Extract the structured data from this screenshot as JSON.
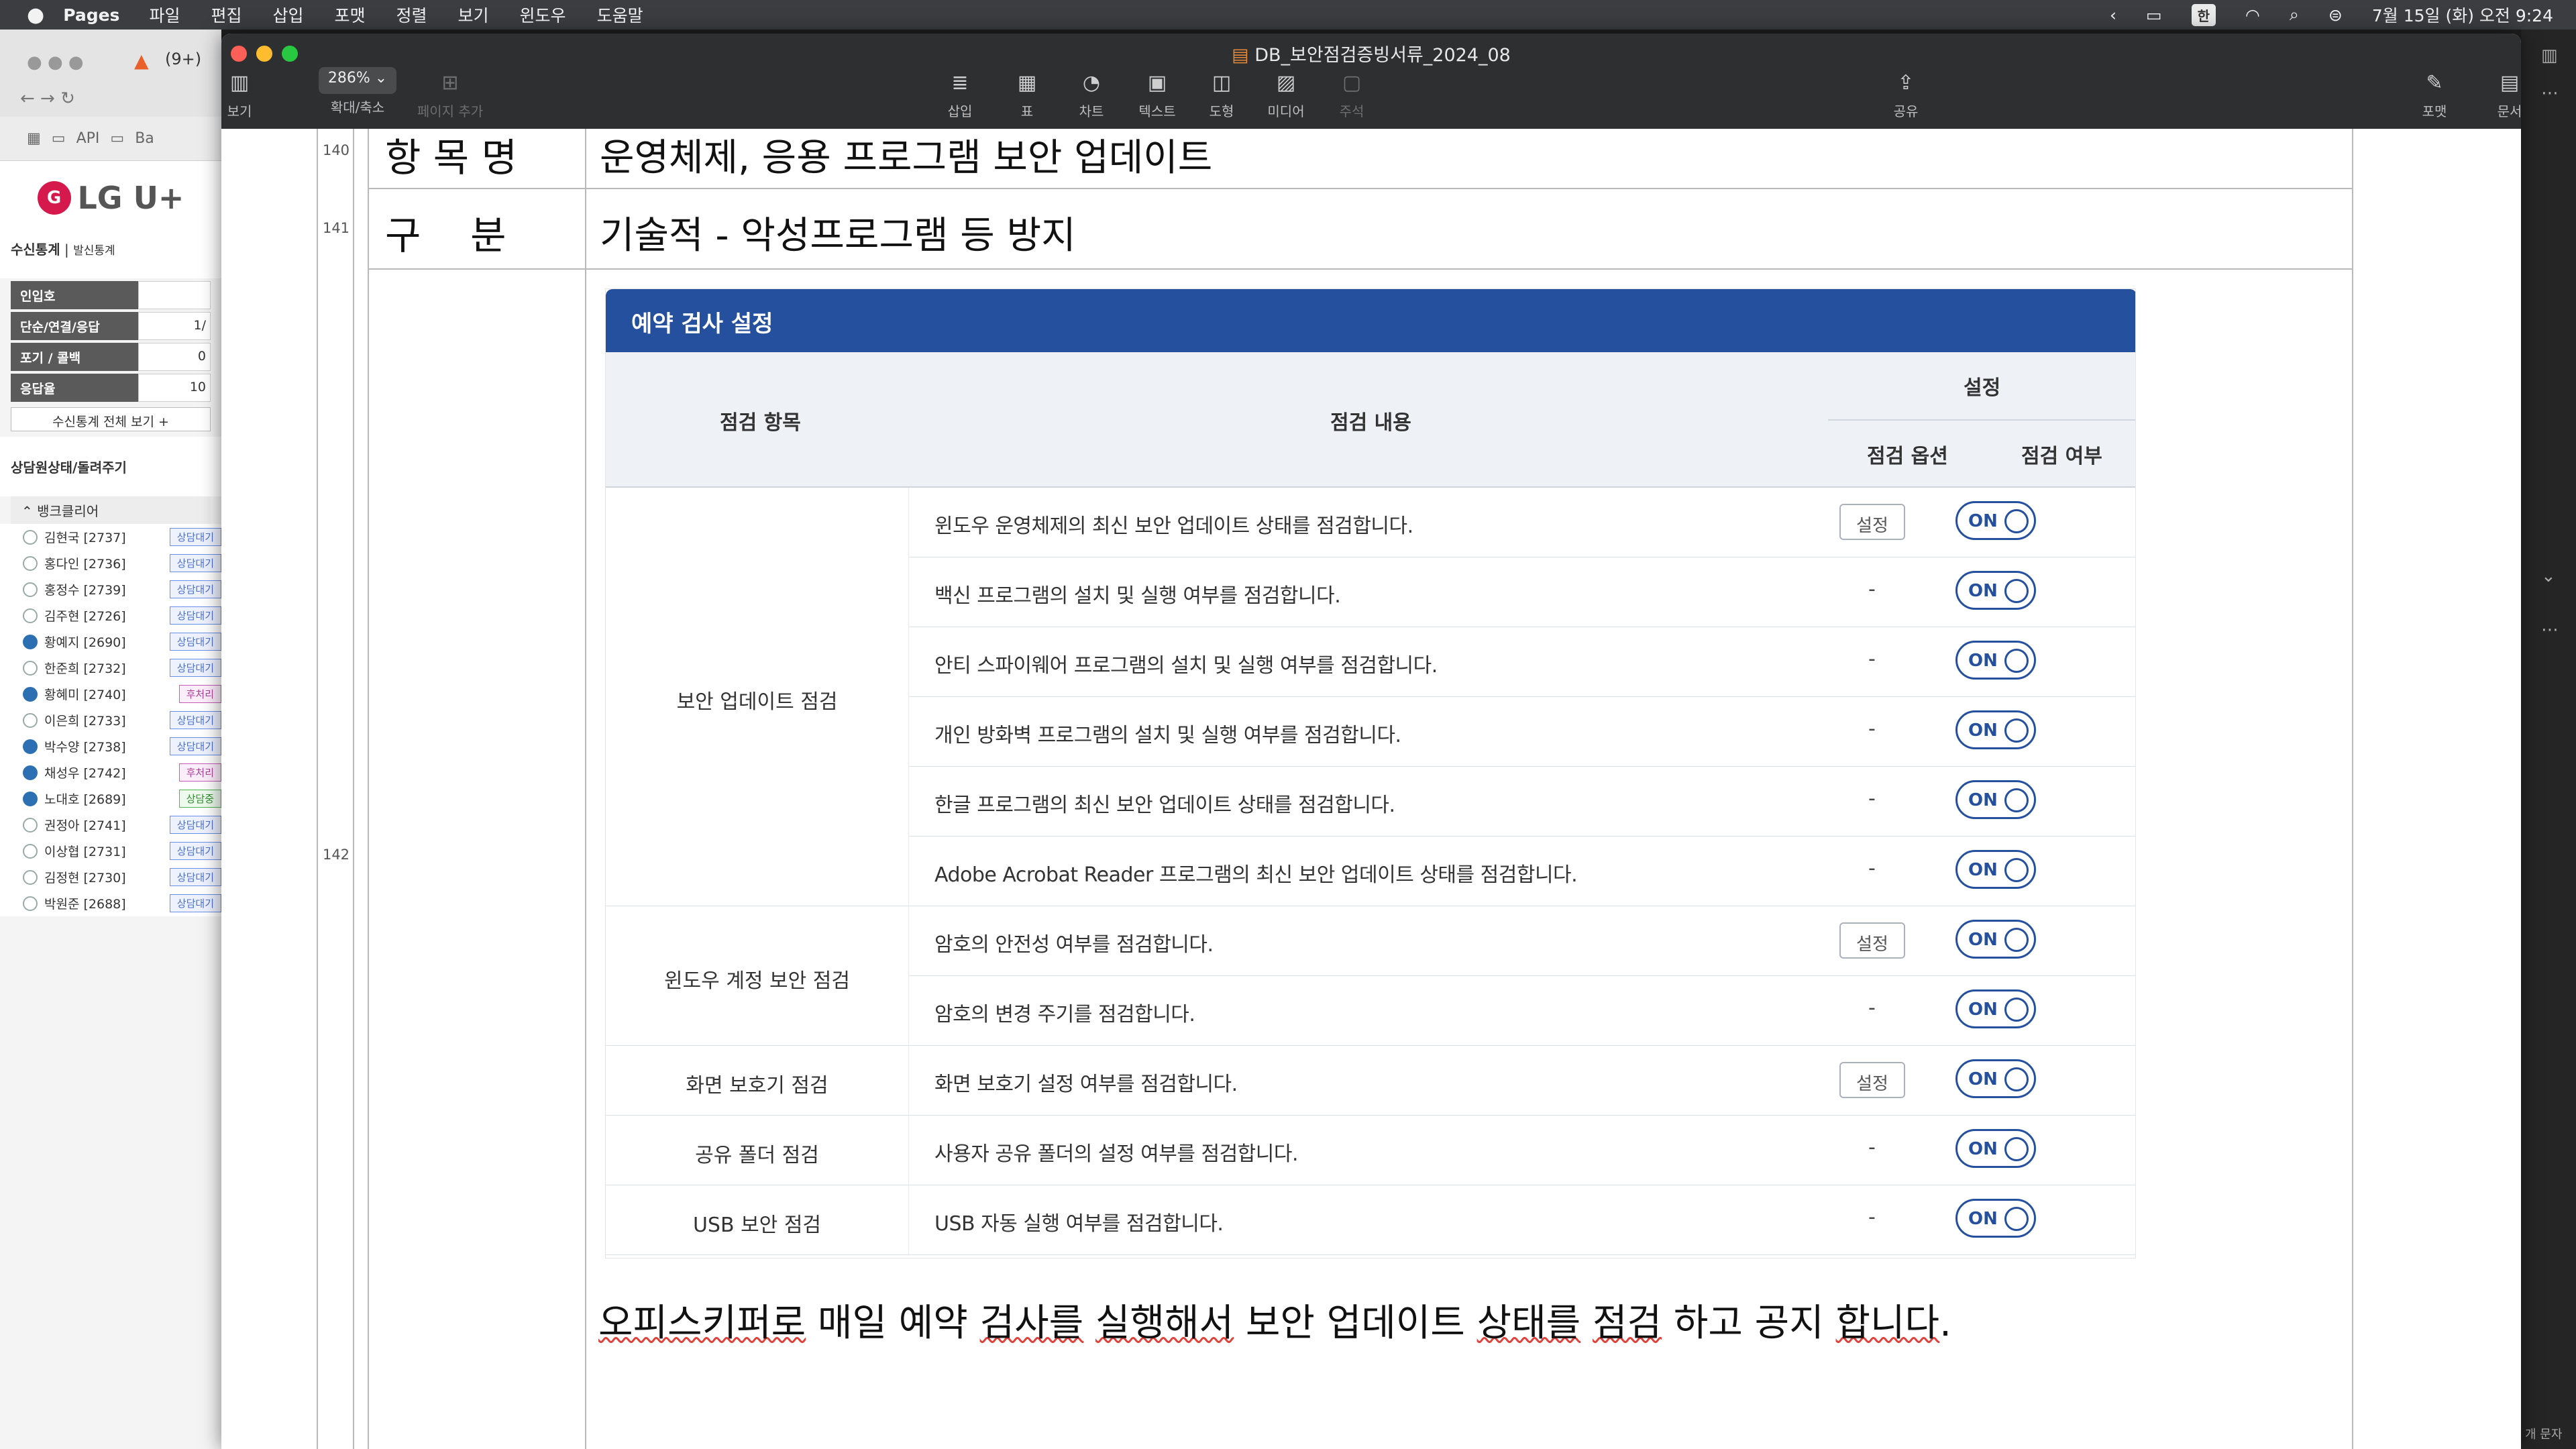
{
  "menubar": {
    "app": "Pages",
    "items": [
      "파일",
      "편집",
      "삽입",
      "포맷",
      "정렬",
      "보기",
      "윈도우",
      "도움말"
    ],
    "input_source": "한",
    "datetime": "7월 15일 (화) 오전 9:24"
  },
  "bg_browser": {
    "tab_label": "(9+)",
    "bookmarks": [
      "API",
      "Ba"
    ],
    "logo": "LG U+",
    "stats_tabs": {
      "active": "수신통계",
      "inactive": "발신통계"
    },
    "stats": [
      {
        "label": "인입호",
        "value": ""
      },
      {
        "label": "단순/연결/응답",
        "value": "1/"
      },
      {
        "label": "포기 / 콜백",
        "value": "0"
      },
      {
        "label": "응답율",
        "value": "10"
      }
    ],
    "more_button": "수신통계 전체 보기 +",
    "section_title": "상담원상태/돌려주기",
    "group_name": "뱅크클리어",
    "agents": [
      {
        "name": "김현국 [2737]",
        "status": "상담대기",
        "tone": "b",
        "active": false
      },
      {
        "name": "홍다인 [2736]",
        "status": "상담대기",
        "tone": "b",
        "active": false
      },
      {
        "name": "홍정수 [2739]",
        "status": "상담대기",
        "tone": "b",
        "active": false
      },
      {
        "name": "김주현 [2726]",
        "status": "상담대기",
        "tone": "b",
        "active": false
      },
      {
        "name": "황예지 [2690]",
        "status": "상담대기",
        "tone": "b",
        "active": true
      },
      {
        "name": "한준희 [2732]",
        "status": "상담대기",
        "tone": "b",
        "active": false
      },
      {
        "name": "황혜미 [2740]",
        "status": "후처리",
        "tone": "p",
        "active": true
      },
      {
        "name": "이은희 [2733]",
        "status": "상담대기",
        "tone": "b",
        "active": false
      },
      {
        "name": "박수양 [2738]",
        "status": "상담대기",
        "tone": "b",
        "active": true
      },
      {
        "name": "채성우 [2742]",
        "status": "후처리",
        "tone": "p",
        "active": true
      },
      {
        "name": "노대호 [2689]",
        "status": "상담중",
        "tone": "g",
        "active": true
      },
      {
        "name": "권정아 [2741]",
        "status": "상담대기",
        "tone": "b",
        "active": false
      },
      {
        "name": "이상협 [2731]",
        "status": "상담대기",
        "tone": "b",
        "active": false
      },
      {
        "name": "김정현 [2730]",
        "status": "상담대기",
        "tone": "b",
        "active": false
      },
      {
        "name": "박원준 [2688]",
        "status": "상담대기",
        "tone": "b",
        "active": false
      }
    ]
  },
  "window": {
    "title": "DB_보안점검증빙서류_2024_08",
    "toolbar": {
      "view": "보기",
      "zoom": "286%",
      "zoom_label": "확대/축소",
      "add_page": "페이지 추가",
      "insert": "삽입",
      "table": "표",
      "chart": "차트",
      "text": "텍스트",
      "shape": "도형",
      "media": "미디어",
      "comment": "주석",
      "share": "공유",
      "format": "포맷",
      "document": "문서"
    }
  },
  "document": {
    "line_numbers": [
      "140",
      "141",
      "142"
    ],
    "row1": {
      "label": "항 목 명",
      "value": "운영체제, 응용 프로그램 보안 업데이트"
    },
    "row2": {
      "label": "구    분",
      "value": "기술적 - 악성프로그램 등 방지"
    },
    "caption": {
      "parts": [
        "오피스키퍼로",
        " 매일 예약 ",
        "검사를",
        " ",
        "실행해서",
        " 보안 업데이트 ",
        "상태를",
        " ",
        "점검",
        " 하고 공지 ",
        "합니다",
        "."
      ]
    }
  },
  "embedded": {
    "header": "예약 검사 설정",
    "columns": {
      "item": "점검 항목",
      "content": "점검 내용",
      "setting": "설정",
      "option": "점검 옵션",
      "enabled": "점검 여부"
    },
    "groups": [
      {
        "name": "보안 업데이트 점검",
        "rows": 6
      },
      {
        "name": "윈도우 계정 보안 점검",
        "rows": 2
      },
      {
        "name": "화면 보호기 점검",
        "rows": 1
      },
      {
        "name": "공유 폴더 점검",
        "rows": 1
      },
      {
        "name": "USB 보안 점검",
        "rows": 1
      }
    ],
    "rows": [
      {
        "desc": "윈도우 운영체제의 최신 보안 업데이트 상태를 점검합니다.",
        "option": "설정",
        "toggle": "ON"
      },
      {
        "desc": "백신 프로그램의 설치 및 실행 여부를 점검합니다.",
        "option": "-",
        "toggle": "ON"
      },
      {
        "desc": "안티 스파이웨어 프로그램의 설치 및 실행 여부를 점검합니다.",
        "option": "-",
        "toggle": "ON"
      },
      {
        "desc": "개인 방화벽 프로그램의 설치 및 실행 여부를 점검합니다.",
        "option": "-",
        "toggle": "ON"
      },
      {
        "desc": "한글 프로그램의 최신 보안 업데이트 상태를 점검합니다.",
        "option": "-",
        "toggle": "ON"
      },
      {
        "desc": "Adobe Acrobat Reader 프로그램의 최신 보안 업데이트 상태를 점검합니다.",
        "option": "-",
        "toggle": "ON"
      },
      {
        "desc": "암호의 안전성 여부를 점검합니다.",
        "option": "설정",
        "toggle": "ON"
      },
      {
        "desc": "암호의 변경 주기를 점검합니다.",
        "option": "-",
        "toggle": "ON"
      },
      {
        "desc": "화면 보호기 설정 여부를 점검합니다.",
        "option": "설정",
        "toggle": "ON"
      },
      {
        "desc": "사용자 공유 폴더의 설정 여부를 점검합니다.",
        "option": "-",
        "toggle": "ON"
      },
      {
        "desc": "USB 자동 실행 여부를 점검합니다.",
        "option": "-",
        "toggle": "ON"
      }
    ]
  },
  "right_strip": {
    "label": "개 문자"
  }
}
